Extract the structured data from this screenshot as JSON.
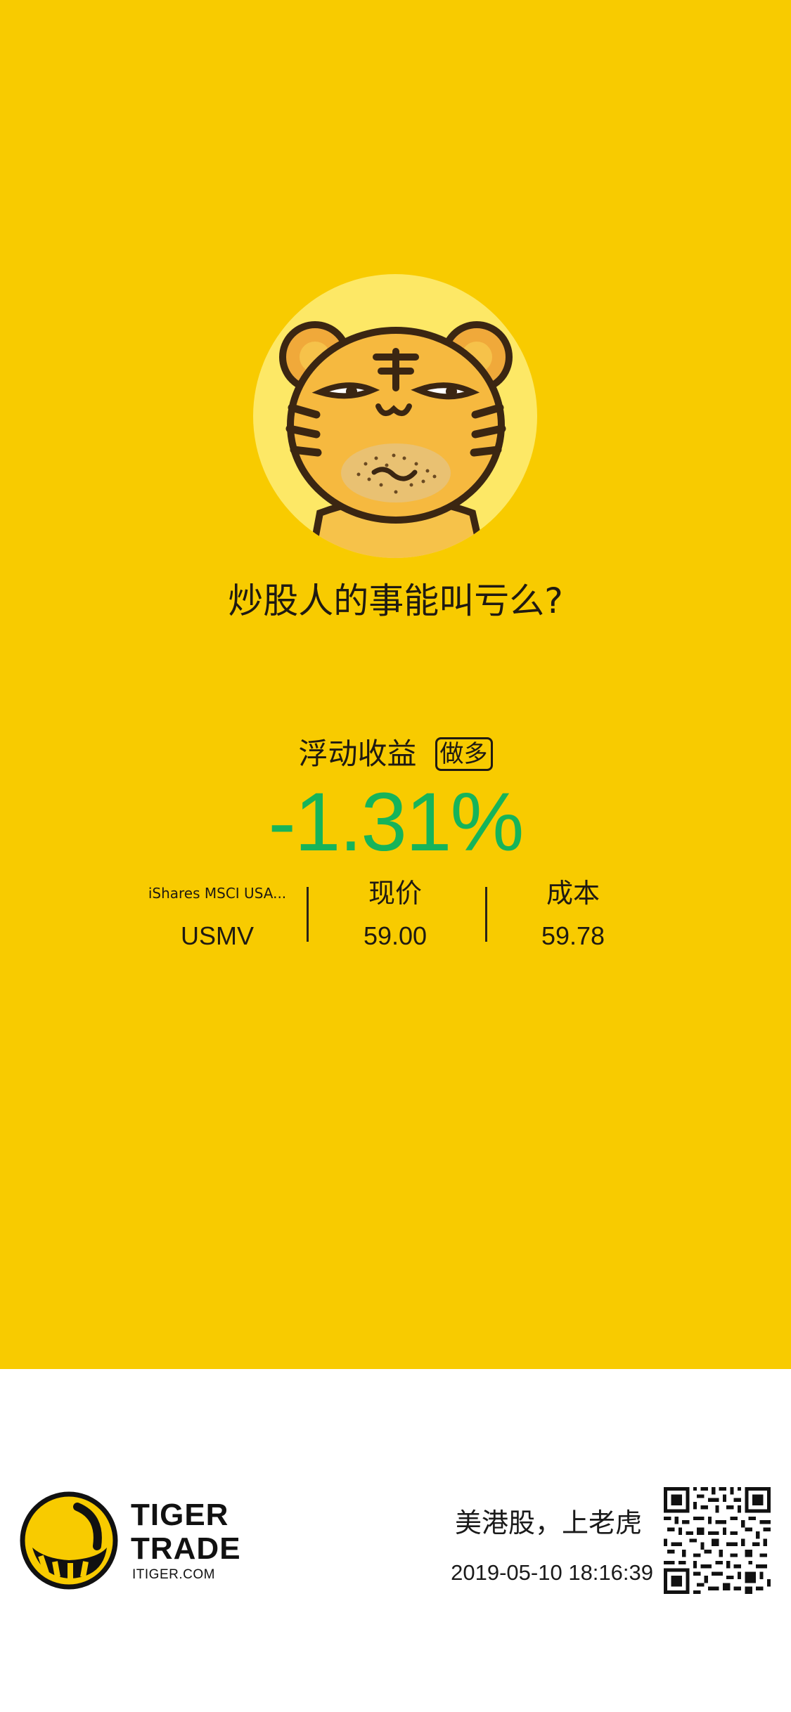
{
  "card": {
    "headline": "炒股人的事能叫亏么?",
    "pnl_label": "浮动收益",
    "position_badge": "做多",
    "pnl_value": "-1.31%",
    "pnl_color": "#16b45a",
    "background_color": "#f8cb00"
  },
  "stats": {
    "security_name": "iShares MSCI USA...",
    "ticker": "USMV",
    "price_label": "现价",
    "price_value": "59.00",
    "cost_label": "成本",
    "cost_value": "59.78"
  },
  "footer": {
    "brand_line1": "TIGER",
    "brand_line2": "TRADE",
    "brand_url": "ITIGER.COM",
    "slogan": "美港股，上老虎",
    "timestamp": "2019-05-10 18:16:39"
  },
  "icons": {
    "mascot": "tiger-mascot-icon",
    "logo": "tiger-trade-logo-icon",
    "qr": "qr-code-icon"
  }
}
